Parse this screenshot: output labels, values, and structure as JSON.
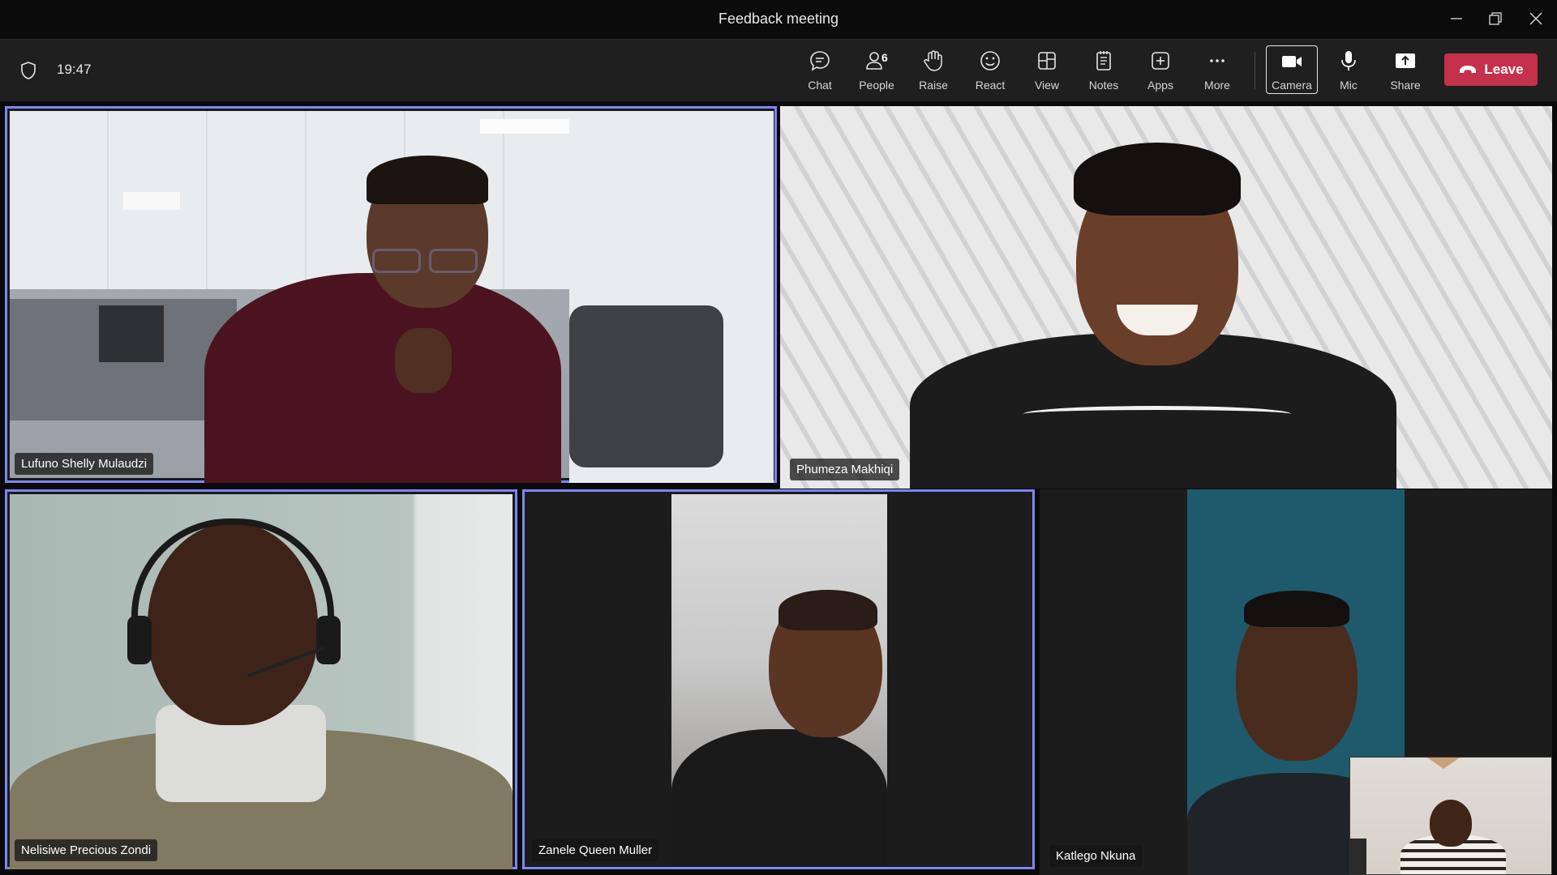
{
  "window": {
    "title": "Feedback meeting"
  },
  "toolbar": {
    "timer": "19:47",
    "people_count": "6",
    "buttons": [
      {
        "label": "Chat",
        "icon": "chat-icon"
      },
      {
        "label": "People",
        "icon": "people-icon"
      },
      {
        "label": "Raise",
        "icon": "raise-hand-icon"
      },
      {
        "label": "React",
        "icon": "react-icon"
      },
      {
        "label": "View",
        "icon": "view-icon"
      },
      {
        "label": "Notes",
        "icon": "notes-icon"
      },
      {
        "label": "Apps",
        "icon": "apps-icon"
      },
      {
        "label": "More",
        "icon": "more-icon"
      },
      {
        "label": "Camera",
        "icon": "camera-icon"
      },
      {
        "label": "Mic",
        "icon": "mic-icon"
      },
      {
        "label": "Share",
        "icon": "share-icon"
      }
    ],
    "leave_label": "Leave"
  },
  "participants": [
    {
      "name": "Lufuno Shelly Mulaudzi"
    },
    {
      "name": "Phumeza Makhiqi"
    },
    {
      "name": "Nelisiwe Precious Zondi"
    },
    {
      "name": "Zanele Queen Muller"
    },
    {
      "name": "Katlego Nkuna"
    }
  ],
  "colors": {
    "active_outline": "#7f85f5",
    "leave": "#c4314b",
    "toolbar": "#1f1f1f"
  }
}
